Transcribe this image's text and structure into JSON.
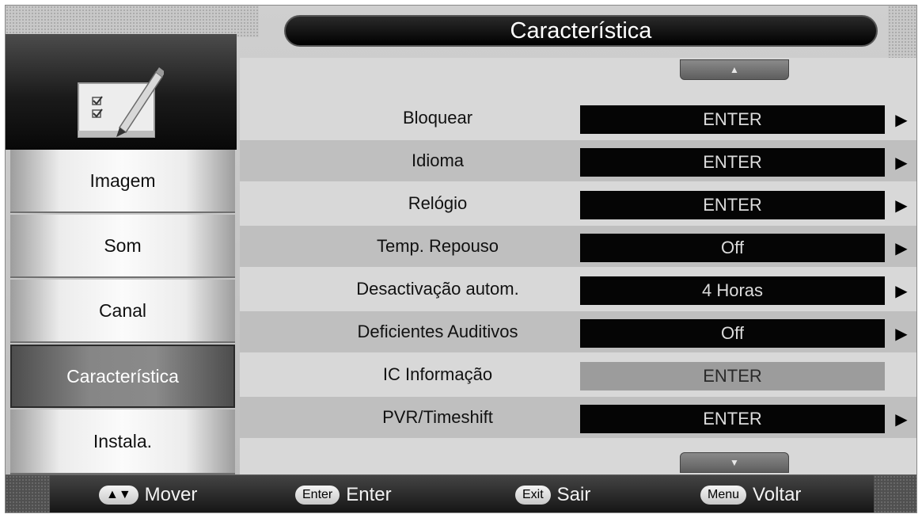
{
  "title": "Característica",
  "sidebar": {
    "items": [
      {
        "label": "Imagem",
        "selected": false
      },
      {
        "label": "Som",
        "selected": false
      },
      {
        "label": "Canal",
        "selected": false
      },
      {
        "label": "Característica",
        "selected": true
      },
      {
        "label": "Instala.",
        "selected": false
      }
    ],
    "icon": "checklist-pencil-icon"
  },
  "menu": {
    "scroll_up_icon": "triangle-up-icon",
    "scroll_down_icon": "triangle-down-icon",
    "rows": [
      {
        "label": "Bloquear",
        "value": "ENTER",
        "enabled": true
      },
      {
        "label": "Idioma",
        "value": "ENTER",
        "enabled": true
      },
      {
        "label": "Relógio",
        "value": "ENTER",
        "enabled": true
      },
      {
        "label": "Temp. Repouso",
        "value": "Off",
        "enabled": true
      },
      {
        "label": "Desactivação autom.",
        "value": "4 Horas",
        "enabled": true
      },
      {
        "label": "Deficientes Auditivos",
        "value": "Off",
        "enabled": true
      },
      {
        "label": "IC Informação",
        "value": "ENTER",
        "enabled": false
      },
      {
        "label": "PVR/Timeshift",
        "value": "ENTER",
        "enabled": true
      }
    ]
  },
  "footer": {
    "hints": [
      {
        "key": "▲▼",
        "text": "Mover"
      },
      {
        "key": "Enter",
        "text": "Enter"
      },
      {
        "key": "Exit",
        "text": "Sair"
      },
      {
        "key": "Menu",
        "text": "Voltar"
      }
    ]
  },
  "colors": {
    "selected_nav": "#7a7a7a",
    "value_box": "#050505",
    "value_box_disabled": "#9c9c9c",
    "title_bar": "#000000",
    "alt_row": "#bfbfbf"
  }
}
